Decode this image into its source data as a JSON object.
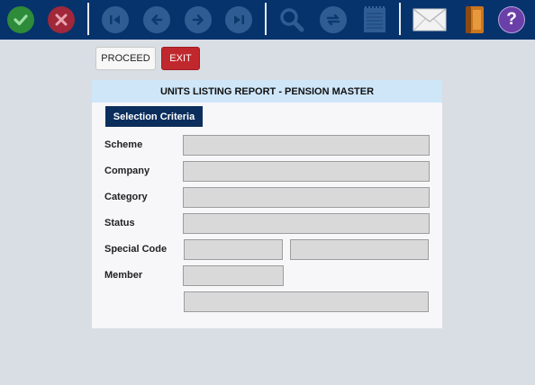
{
  "toolbar": {
    "icons": [
      "check-icon",
      "cancel-icon",
      "first-icon",
      "previous-icon",
      "next-icon",
      "last-icon",
      "search-icon",
      "refresh-icon",
      "notepad-icon",
      "mail-icon",
      "book-icon",
      "help-icon"
    ],
    "help_glyph": "?",
    "colors": {
      "bar": "#06336b",
      "check": "#2e8b3a",
      "cancel": "#a0283a",
      "disabled": "#2f5d93",
      "help": "#6b3fa8"
    }
  },
  "actions": {
    "proceed_label": "PROCEED",
    "exit_label": "EXIT"
  },
  "report": {
    "title": "UNITS LISTING REPORT - PENSION MASTER",
    "tab_label": "Selection Criteria",
    "fields": {
      "scheme": {
        "label": "Scheme",
        "value": ""
      },
      "company": {
        "label": "Company",
        "value": ""
      },
      "category": {
        "label": "Category",
        "value": ""
      },
      "status": {
        "label": "Status",
        "value": ""
      },
      "special_code": {
        "label": "Special Code",
        "value_from": "",
        "value_to": ""
      },
      "member": {
        "label": "Member",
        "value": "",
        "name_value": ""
      }
    }
  },
  "colors": {
    "background": "#d9dde4",
    "panel": "#f7f6f8",
    "header": "#cfe6f8",
    "tab": "#0b2e5c",
    "exit": "#c0282d"
  }
}
